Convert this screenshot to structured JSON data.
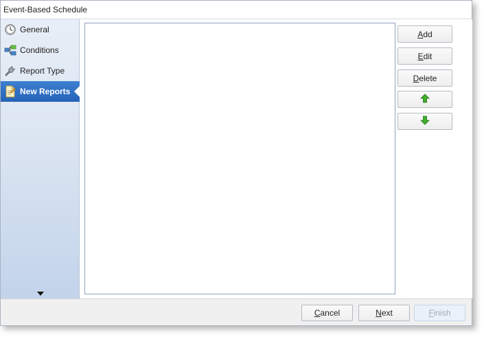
{
  "window": {
    "title": "Event-Based Schedule"
  },
  "sidebar": {
    "items": [
      {
        "label": "General",
        "icon": "clock-icon",
        "selected": false
      },
      {
        "label": "Conditions",
        "icon": "conditions-icon",
        "selected": false
      },
      {
        "label": "Report Type",
        "icon": "wrench-icon",
        "selected": false
      },
      {
        "label": "New Reports",
        "icon": "report-icon",
        "selected": true
      }
    ],
    "more_icon": "chevron-down-icon"
  },
  "actions": {
    "add": {
      "accel": "A",
      "rest": "dd"
    },
    "edit": {
      "accel": "E",
      "rest": "dit"
    },
    "delete": {
      "accel": "D",
      "rest": "elete"
    },
    "move_up_icon": "arrow-up-icon",
    "move_down_icon": "arrow-down-icon",
    "arrow_color": "#3fae2a"
  },
  "footer": {
    "cancel": {
      "accel": "C",
      "rest": "ancel"
    },
    "next": {
      "accel": "N",
      "rest": "ext"
    },
    "finish": {
      "accel": "F",
      "rest": "inish",
      "enabled": false
    }
  },
  "colors": {
    "selected_nav": "#2f6fc4",
    "sidebar_top": "#e8eef7",
    "sidebar_bottom": "#c2d3ea"
  }
}
